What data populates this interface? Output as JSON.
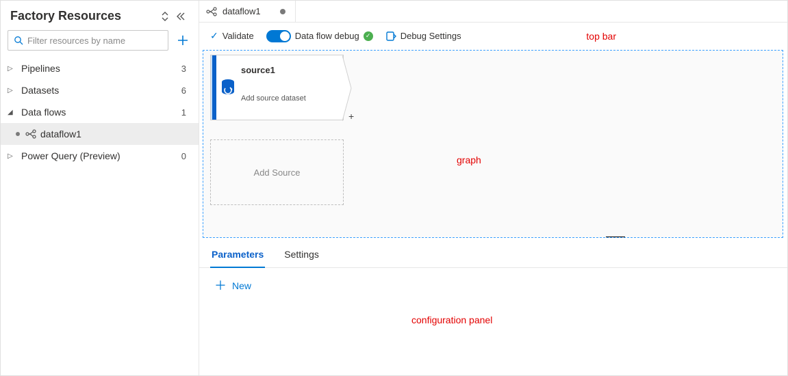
{
  "sidebar": {
    "title": "Factory Resources",
    "search_placeholder": "Filter resources by name",
    "tree": [
      {
        "label": "Pipelines",
        "count": "3",
        "expanded": false
      },
      {
        "label": "Datasets",
        "count": "6",
        "expanded": false
      },
      {
        "label": "Data flows",
        "count": "1",
        "expanded": true,
        "children": [
          {
            "label": "dataflow1",
            "selected": true,
            "dirty": true
          }
        ]
      },
      {
        "label": "Power Query (Preview)",
        "count": "0",
        "expanded": false
      }
    ]
  },
  "tab": {
    "label": "dataflow1",
    "dirty": true
  },
  "topbar": {
    "validate": "Validate",
    "debug_label": "Data flow debug",
    "debug_on": true,
    "debug_status": "ok",
    "debug_settings": "Debug Settings"
  },
  "graph": {
    "source_card": {
      "title": "source1",
      "subtitle": "Add source dataset"
    },
    "add_source": "Add Source"
  },
  "config": {
    "tabs": [
      {
        "label": "Parameters",
        "active": true
      },
      {
        "label": "Settings",
        "active": false
      }
    ],
    "new_label": "New"
  },
  "annotations": {
    "topbar": "top bar",
    "graph": "graph",
    "config": "configuration panel"
  }
}
